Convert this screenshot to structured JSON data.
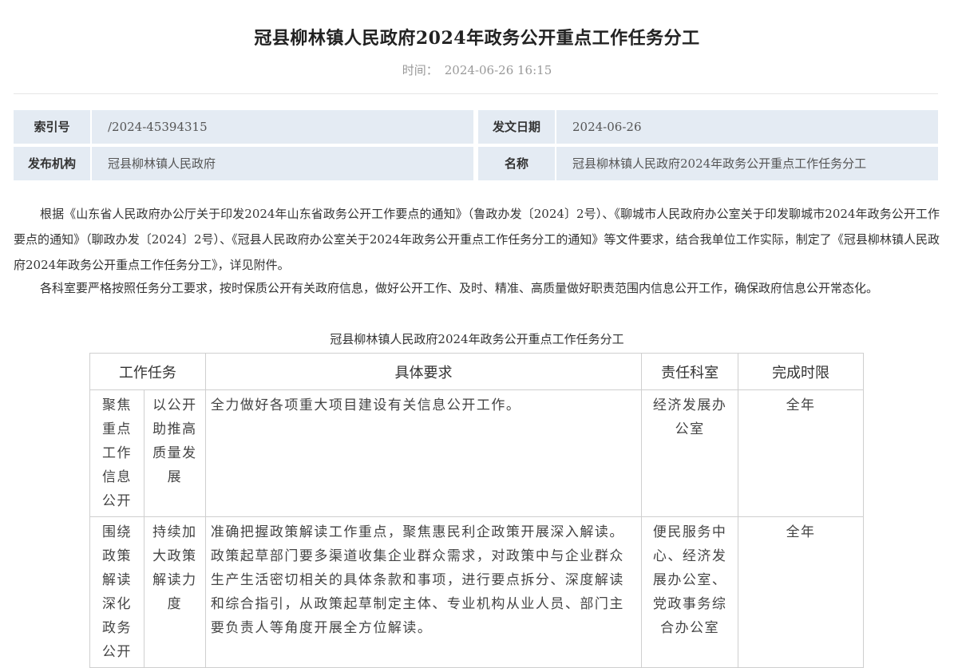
{
  "article": {
    "title": "冠县柳林镇人民政府2024年政务公开重点工作任务分工",
    "time_label": "时间：",
    "time_value": "2024-06-26 16:15"
  },
  "info": {
    "index_label": "索引号",
    "index_value": "/2024-45394315",
    "date_label": "发文日期",
    "date_value": "2024-06-26",
    "org_label": "发布机构",
    "org_value": "冠县柳林镇人民政府",
    "name_label": "名称",
    "name_value": "冠县柳林镇人民政府2024年政务公开重点工作任务分工"
  },
  "body": {
    "paragraph1": "根据《山东省人民政府办公厅关于印发2024年山东省政务公开工作要点的通知》（鲁政办发〔2024〕2号）、《聊城市人民政府办公室关于印发聊城市2024年政务公开工作要点的通知》（聊政办发〔2024〕2号）、《冠县人民政府办公室关于2024年政务公开重点工作任务分工的通知》等文件要求，结合我单位工作实际，制定了《冠县柳林镇人民政府2024年政务公开重点工作任务分工》，详见附件。",
    "paragraph2": "各科室要严格按照任务分工要求，按时保质公开有关政府信息，做好公开工作、及时、精准、高质量做好职责范围内信息公开工作，确保政府信息公开常态化。"
  },
  "task_table": {
    "caption": "冠县柳林镇人民政府2024年政务公开重点工作任务分工",
    "headers": [
      "工作任务",
      "具体要求",
      "责任科室",
      "完成时限"
    ],
    "rows": [
      {
        "category": "聚焦重点工作信息公开",
        "subtask": "以公开助推高质量发展",
        "requirement": "全力做好各项重大项目建设有关信息公开工作。",
        "department": "经济发展办公室",
        "deadline": "全年"
      },
      {
        "category": "围绕政策解读深化政务公开",
        "subtask": "持续加大政策解读力度",
        "requirement": "准确把握政策解读工作重点，聚焦惠民利企政策开展深入解读。政策起草部门要多渠道收集企业群众需求，对政策中与企业群众生产生活密切相关的具体条款和事项，进行要点拆分、深度解读和综合指引，从政策起草制定主体、专业机构从业人员、部门主要负责人等角度开展全方位解读。",
        "department": "便民服务中心、经济发展办公室、党政事务综合办公室",
        "deadline": "全年"
      }
    ]
  }
}
